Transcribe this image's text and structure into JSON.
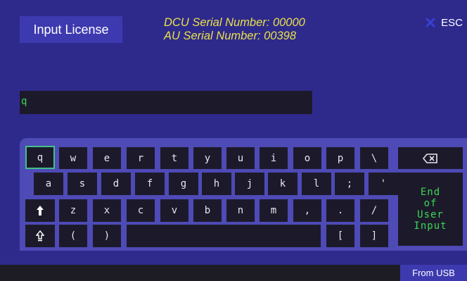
{
  "header": {
    "title": "Input License",
    "dcu_serial": "DCU Serial Number: 00000",
    "au_serial": "AU Serial Number: 00398",
    "esc_label": "ESC",
    "esc_icon": "close-icon"
  },
  "input": {
    "value": "q"
  },
  "keyboard": {
    "keys": [
      "q",
      "w",
      "e",
      "r",
      "t",
      "y",
      "u",
      "i",
      "o",
      "p",
      "\\",
      "a",
      "s",
      "d",
      "f",
      "g",
      "h",
      "j",
      "k",
      "l",
      ";",
      "'",
      "z",
      "x",
      "c",
      "v",
      "b",
      "n",
      "m",
      ",",
      ".",
      "/",
      "(",
      ")",
      "[",
      "]"
    ],
    "special": {
      "backspace_icon": "backspace-icon",
      "shift_icon": "shift-icon",
      "caps_icon": "caps-lock-icon",
      "space_label": "",
      "end_input_label": "End\nof\nUser\nInput"
    },
    "selected_key": "q"
  },
  "footer": {
    "from_usb_label": "From USB"
  },
  "colors": {
    "background": "#2e2a8c",
    "panel": "#4e4ab6",
    "key": "#1c1a2a",
    "accent_green": "#3cd657",
    "serial_yellow": "#e9e04a"
  }
}
